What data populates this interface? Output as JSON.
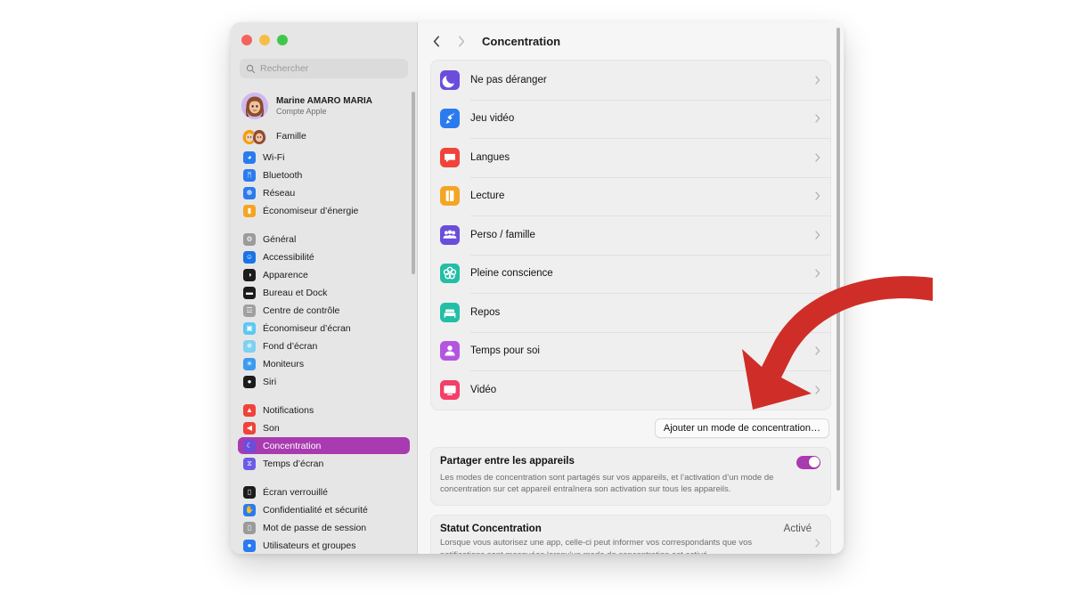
{
  "window": {
    "traffic_lights": [
      "close",
      "minimize",
      "zoom"
    ],
    "colors": {
      "accent": "#a93bb0",
      "arrow": "#cf2e28",
      "sidebar_bg": "#e7e6e6",
      "content_bg": "#f6f6f6",
      "card_bg": "#f0efef"
    }
  },
  "sidebar": {
    "search": {
      "placeholder": "Rechercher",
      "value": "",
      "icon": "search-icon"
    },
    "account": {
      "name": "Marine AMARO MARIA",
      "subtitle": "Compte Apple",
      "avatar_icon": "memoji-avatar"
    },
    "family": {
      "label": "Famille",
      "icon": "family-memoji-icon"
    },
    "groups": [
      {
        "items": [
          {
            "label": "Wi-Fi",
            "icon": "wifi-icon",
            "color": "#2a7bf0",
            "glyph": "◕"
          },
          {
            "label": "Bluetooth",
            "icon": "bluetooth-icon",
            "color": "#2a7bf0",
            "glyph": "ᛗ"
          },
          {
            "label": "Réseau",
            "icon": "network-icon",
            "color": "#2a7bf0",
            "glyph": "☸"
          },
          {
            "label": "Économiseur d’énergie",
            "icon": "battery-icon",
            "color": "#f5a524",
            "glyph": "▮"
          }
        ]
      },
      {
        "items": [
          {
            "label": "Général",
            "icon": "general-gear-icon",
            "color": "#9b9b9b",
            "glyph": "⚙"
          },
          {
            "label": "Accessibilité",
            "icon": "accessibility-icon",
            "color": "#1a73e8",
            "glyph": "☺"
          },
          {
            "label": "Apparence",
            "icon": "appearance-icon",
            "color": "#1c1c1c",
            "glyph": "◑"
          },
          {
            "label": "Bureau et Dock",
            "icon": "desktop-dock-icon",
            "color": "#1c1c1c",
            "glyph": "▬"
          },
          {
            "label": "Centre de contrôle",
            "icon": "control-center-icon",
            "color": "#a0a0a0",
            "glyph": "☲"
          },
          {
            "label": "Économiseur d’écran",
            "icon": "screensaver-icon",
            "color": "#5ac8f5",
            "glyph": "▣"
          },
          {
            "label": "Fond d’écran",
            "icon": "wallpaper-icon",
            "color": "#7fd0f2",
            "glyph": "✵"
          },
          {
            "label": "Moniteurs",
            "icon": "displays-icon",
            "color": "#3a9bf0",
            "glyph": "☀"
          },
          {
            "label": "Siri",
            "icon": "siri-icon",
            "color": "#1c1c1c",
            "glyph": "●"
          }
        ]
      },
      {
        "items": [
          {
            "label": "Notifications",
            "icon": "notifications-icon",
            "color": "#f0433a",
            "glyph": "▲"
          },
          {
            "label": "Son",
            "icon": "sound-icon",
            "color": "#f0433a",
            "glyph": "◀"
          },
          {
            "label": "Concentration",
            "icon": "focus-moon-icon",
            "color": "#6b4ddb",
            "glyph": "☾",
            "selected": true
          },
          {
            "label": "Temps d’écran",
            "icon": "screen-time-icon",
            "color": "#6b5ce7",
            "glyph": "⧖"
          }
        ]
      },
      {
        "items": [
          {
            "label": "Écran verrouillé",
            "icon": "lock-screen-icon",
            "color": "#1c1c1c",
            "glyph": "▯"
          },
          {
            "label": "Confidentialité et sécurité",
            "icon": "privacy-hand-icon",
            "color": "#2a7bf0",
            "glyph": "✋"
          },
          {
            "label": "Mot de passe de session",
            "icon": "login-password-icon",
            "color": "#9b9b9b",
            "glyph": "▯"
          },
          {
            "label": "Utilisateurs et groupes",
            "icon": "users-groups-icon",
            "color": "#2a7bf0",
            "glyph": "●"
          }
        ]
      }
    ]
  },
  "titlebar": {
    "back_icon": "chevron-left-icon",
    "forward_icon": "chevron-right-icon",
    "title": "Concentration"
  },
  "focus_modes": [
    {
      "label": "Ne pas déranger",
      "icon": "moon-icon",
      "color": "#6b4ddb"
    },
    {
      "label": "Jeu vidéo",
      "icon": "rocket-icon",
      "color": "#2a7bf0"
    },
    {
      "label": "Langues",
      "icon": "speech-bubble-icon",
      "color": "#f0433a"
    },
    {
      "label": "Lecture",
      "icon": "book-icon",
      "color": "#f5a524"
    },
    {
      "label": "Perso / famille",
      "icon": "people-icon",
      "color": "#6b4ddb"
    },
    {
      "label": "Pleine conscience",
      "icon": "mindfulness-flower-icon",
      "color": "#22bfa6"
    },
    {
      "label": "Repos",
      "icon": "bed-icon",
      "color": "#22bfa6"
    },
    {
      "label": "Temps pour soi",
      "icon": "person-icon",
      "color": "#b355e0"
    },
    {
      "label": "Vidéo",
      "icon": "tv-icon",
      "color": "#f43f6a"
    }
  ],
  "add_button": {
    "label": "Ajouter un mode de concentration…"
  },
  "share_panel": {
    "title": "Partager entre les appareils",
    "description": "Les modes de concentration sont partagés sur vos appareils, et l’activation d’un mode de concentration sur cet appareil entraînera son activation sur tous les appareils.",
    "toggle_state": "on"
  },
  "status_panel": {
    "title": "Statut Concentration",
    "value": "Activé",
    "description": "Lorsque vous autorisez une app, celle-ci peut informer vos correspondants que vos notifications sont masquées lorsqu'un mode de concentration est activé."
  },
  "annotation": {
    "arrow_icon": "red-curved-arrow-icon",
    "points_to": "Ajouter un mode de concentration…"
  }
}
